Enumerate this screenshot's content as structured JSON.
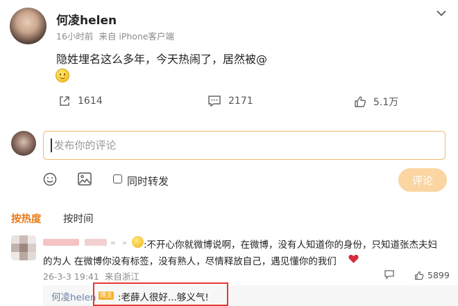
{
  "post": {
    "author": "何凌helen",
    "time": "16小时前",
    "source": "来自 iPhone客户端",
    "text": "隐姓埋名这么多年，今天热闹了，居然被@",
    "emoji": "smile-emoji",
    "reposts": "1614",
    "comments": "2171",
    "likes": "5.1万"
  },
  "composer": {
    "placeholder": "发布你的评论",
    "repost_label": "同时转发",
    "submit_label": "评论"
  },
  "sort_tabs": {
    "hot": "按热度",
    "time": "按时间"
  },
  "comment": {
    "line1": ":不开心你就微博说啊，在微博，没有人知道你的身份，只知道张杰夫妇",
    "line2": "的为人  在微博你没有标签，没有熟人，尽情释放自己，遇见懂你的我们",
    "date": "26-3-3 19:41",
    "location": "来自浙江",
    "likes": "5899"
  },
  "reply": {
    "author": "何凌helen",
    "badge": "博主",
    "text": ":老薛人很好...够义气!"
  },
  "colors": {
    "accent": "#e87a16",
    "highlight_border": "#e53935",
    "link": "#6a7fa8"
  }
}
